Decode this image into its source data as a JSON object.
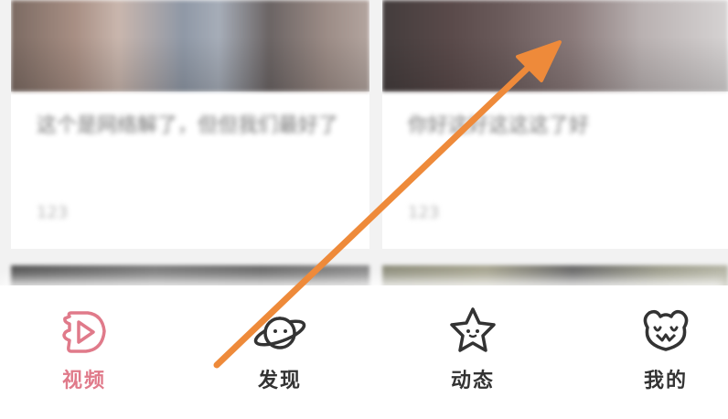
{
  "feed": {
    "cards": [
      {
        "title": "这个是网络解了，但但我们最好了",
        "meta": "123"
      },
      {
        "title": "你好这好这这这了好",
        "meta": "123"
      }
    ]
  },
  "tabbar": {
    "active_color": "#e07a8a",
    "items": [
      {
        "label": "视频",
        "icon": "video-play-icon",
        "active": true
      },
      {
        "label": "发现",
        "icon": "planet-icon",
        "active": false
      },
      {
        "label": "动态",
        "icon": "star-face-icon",
        "active": false
      },
      {
        "label": "我的",
        "icon": "koala-face-icon",
        "active": false
      }
    ]
  },
  "annotation": {
    "arrow_color": "#ee8a3a"
  }
}
